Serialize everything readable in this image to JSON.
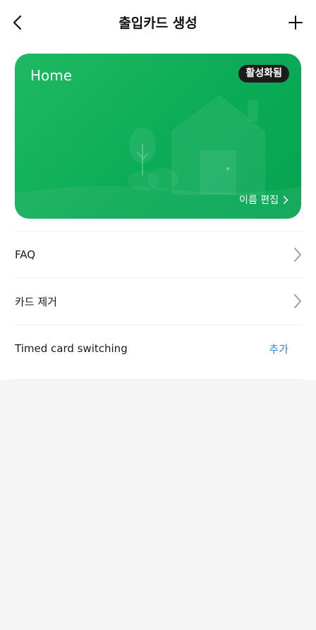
{
  "header": {
    "title": "출입카드 생성",
    "back_icon": "chevron-left-icon",
    "add_icon": "plus-icon"
  },
  "card": {
    "name": "Home",
    "status_badge": "활성화됨",
    "edit_label": "이름 편집",
    "edit_icon": "chevron-right-icon",
    "color": "#0bab57"
  },
  "menu": {
    "faq_label": "FAQ",
    "remove_card_label": "카드 제거",
    "timed_switching_label": "Timed card switching",
    "timed_switching_action": "추가"
  },
  "colors": {
    "accent_link": "#2f88d8",
    "card_green": "#0bab57",
    "badge_bg": "#1c1c1c"
  }
}
